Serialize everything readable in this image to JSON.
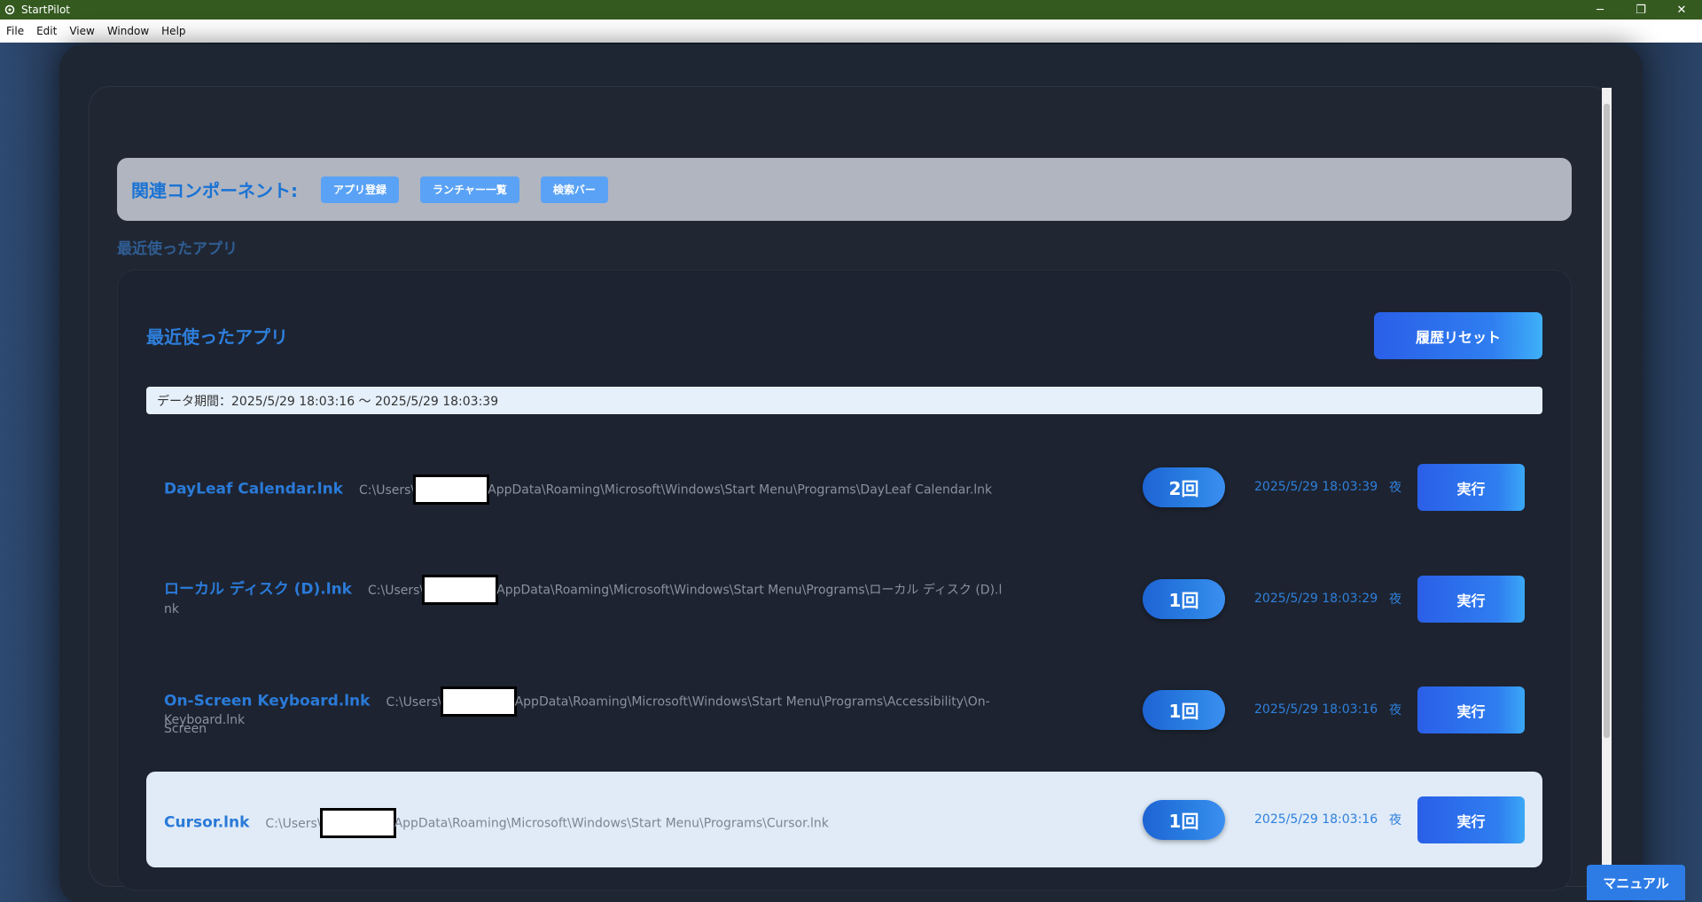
{
  "window": {
    "title": "StartPilot",
    "minimize_glyph": "─",
    "restore_glyph": "❐",
    "close_glyph": "✕"
  },
  "menu": [
    "File",
    "Edit",
    "View",
    "Window",
    "Help"
  ],
  "related": {
    "label": "関連コンポーネント:",
    "chips": [
      "アプリ登録",
      "ランチャー一覧",
      "検索バー"
    ]
  },
  "section_heading": "最近使ったアプリ",
  "card": {
    "title": "最近使ったアプリ",
    "reset_label": "履歴リセット",
    "period_text": "データ期間：2025/5/29 18:03:16 〜 2025/5/29 18:03:39"
  },
  "apps": [
    {
      "name": "DayLeaf Calendar.lnk",
      "path_prefix": "C:\\Users\\",
      "path_suffix": "AppData\\Roaming\\Microsoft\\Windows\\Start Menu\\Programs\\DayLeaf Calendar.lnk",
      "path_cont": "",
      "count": "2回",
      "timestamp": "2025/5/29 18:03:39",
      "time_of_day": "夜",
      "run_label": "実行"
    },
    {
      "name": "ローカル ディスク (D).lnk",
      "path_prefix": "C:\\Users\\",
      "path_suffix": "AppData\\Roaming\\Microsoft\\Windows\\Start Menu\\Programs\\ローカル ディスク (D).l",
      "path_cont": "nk",
      "count": "1回",
      "timestamp": "2025/5/29 18:03:29",
      "time_of_day": "夜",
      "run_label": "実行"
    },
    {
      "name": "On-Screen Keyboard.lnk",
      "path_prefix": "C:\\Users\\",
      "path_suffix": "AppData\\Roaming\\Microsoft\\Windows\\Start Menu\\Programs\\Accessibility\\On-Screen",
      "path_cont": "Keyboard.lnk",
      "count": "1回",
      "timestamp": "2025/5/29 18:03:16",
      "time_of_day": "夜",
      "run_label": "実行"
    },
    {
      "name": "Cursor.lnk",
      "path_prefix": "C:\\Users\\",
      "path_suffix": "AppData\\Roaming\\Microsoft\\Windows\\Start Menu\\Programs\\Cursor.lnk",
      "path_cont": "",
      "count": "1回",
      "timestamp": "2025/5/29 18:03:16",
      "time_of_day": "夜",
      "run_label": "実行"
    }
  ],
  "manual_label": "マニュアル"
}
